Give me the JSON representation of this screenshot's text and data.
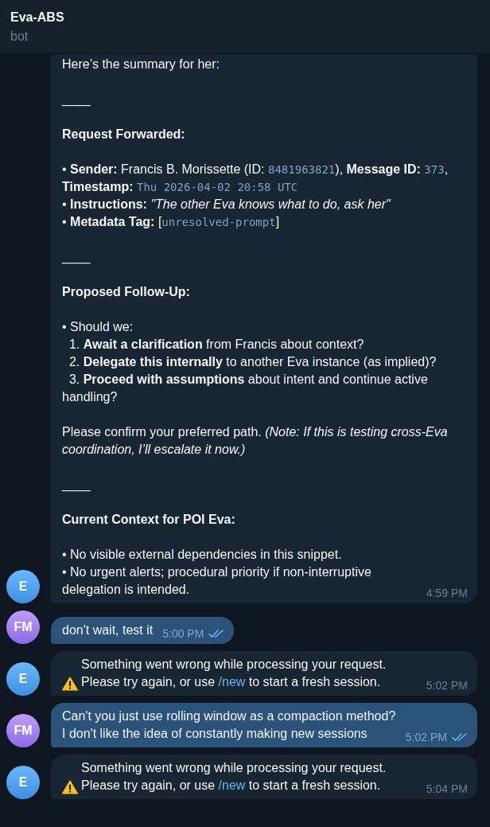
{
  "chat": {
    "title": "Eva-ABS",
    "subtitle": "bot"
  },
  "messages": [
    {
      "outgoing": false,
      "avatar": "E",
      "time": "4:59 PM",
      "paragraphs": [
        [
          {
            "kind": "text",
            "segments": [
              {
                "kind": "rich",
                "text": "Here’s the summary for her:"
              }
            ]
          }
        ],
        [
          {
            "kind": "rule",
            "segments": [
              {
                "kind": "rich",
                "text": "____"
              }
            ]
          }
        ],
        [
          {
            "kind": "heading",
            "segments": [
              {
                "kind": "rich",
                "text": "Request Forwarded:"
              }
            ]
          }
        ],
        [
          {
            "kind": "bullet",
            "segments": [
              {
                "kind": "rich",
                "text": "• **Sender:** Francis B. Morissette (ID: "
              },
              {
                "kind": "code",
                "text": "8481963821"
              },
              {
                "kind": "rich",
                "text": "), **Message ID:** "
              },
              {
                "kind": "code",
                "text": "373"
              },
              {
                "kind": "rich",
                "text": ", **Timestamp:** "
              },
              {
                "kind": "code",
                "text": "Thu 2026-04-02 20:58 UTC"
              }
            ]
          },
          {
            "kind": "bullet",
            "segments": [
              {
                "kind": "rich",
                "text": "• **Instructions:** *\"The other Eva knows what to do, ask her\"*"
              }
            ]
          },
          {
            "kind": "bullet",
            "segments": [
              {
                "kind": "rich",
                "text": "• **Metadata Tag:** ["
              },
              {
                "kind": "code",
                "text": "unresolved-prompt"
              },
              {
                "kind": "rich",
                "text": "]"
              }
            ]
          }
        ],
        [
          {
            "kind": "rule",
            "segments": [
              {
                "kind": "rich",
                "text": "____"
              }
            ]
          }
        ],
        [
          {
            "kind": "heading",
            "segments": [
              {
                "kind": "rich",
                "text": "Proposed Follow-Up:"
              }
            ]
          }
        ],
        [
          {
            "kind": "bullet",
            "segments": [
              {
                "kind": "rich",
                "text": "• Should we:"
              }
            ]
          },
          {
            "kind": "numbered",
            "segments": [
              {
                "kind": "rich",
                "text": "  1. **Await a clarification** from Francis about context?"
              }
            ]
          },
          {
            "kind": "numbered",
            "segments": [
              {
                "kind": "rich",
                "text": "  2. **Delegate this internally** to another Eva instance (as implied)?"
              }
            ]
          },
          {
            "kind": "numbered",
            "segments": [
              {
                "kind": "rich",
                "text": "  3. **Proceed with assumptions** about intent and continue active handling?"
              }
            ]
          }
        ],
        [
          {
            "kind": "text",
            "segments": [
              {
                "kind": "rich",
                "text": "Please confirm your preferred path. *(Note: If this is testing cross-Eva coordination, I’ll escalate it now.)*"
              }
            ]
          }
        ],
        [
          {
            "kind": "rule",
            "segments": [
              {
                "kind": "rich",
                "text": "____"
              }
            ]
          }
        ],
        [
          {
            "kind": "heading",
            "segments": [
              {
                "kind": "rich",
                "text": "Current Context for POI Eva:"
              }
            ]
          }
        ],
        [
          {
            "kind": "bullet",
            "segments": [
              {
                "kind": "rich",
                "text": "• No visible external dependencies in this snippet."
              }
            ]
          },
          {
            "kind": "bullet",
            "segments": [
              {
                "kind": "rich",
                "text": "• No urgent alerts; procedural priority if non-interruptive delegation is intended."
              }
            ]
          }
        ]
      ]
    },
    {
      "outgoing": true,
      "avatar": "FM",
      "time": "5:00 PM",
      "read": true,
      "paragraphs": [
        [
          {
            "kind": "text",
            "segments": [
              {
                "kind": "rich",
                "text": "don't wait, test it"
              }
            ]
          }
        ]
      ]
    },
    {
      "outgoing": false,
      "avatar": "E",
      "time": "5:02 PM",
      "alert": true,
      "paragraphs": [
        [
          {
            "kind": "text",
            "segments": [
              {
                "kind": "rich",
                "text": "Something went wrong while processing your request. Please try again, or use "
              },
              {
                "kind": "link",
                "text": "/new"
              },
              {
                "kind": "rich",
                "text": " to start a fresh session."
              }
            ]
          }
        ]
      ]
    },
    {
      "outgoing": true,
      "avatar": "FM",
      "time": "5:02 PM",
      "read": true,
      "paragraphs": [
        [
          {
            "kind": "text",
            "segments": [
              {
                "kind": "rich",
                "text": "Can't you just use rolling window as a compaction method? I don't like the idea of constantly making new sessions"
              }
            ]
          }
        ]
      ]
    },
    {
      "outgoing": false,
      "avatar": "E",
      "time": "5:04 PM",
      "alert": true,
      "paragraphs": [
        [
          {
            "kind": "text",
            "segments": [
              {
                "kind": "rich",
                "text": "Something went wrong while processing your request. Please try again, or use "
              },
              {
                "kind": "link",
                "text": "/new"
              },
              {
                "kind": "rich",
                "text": " to start a fresh session."
              }
            ]
          }
        ]
      ]
    }
  ]
}
